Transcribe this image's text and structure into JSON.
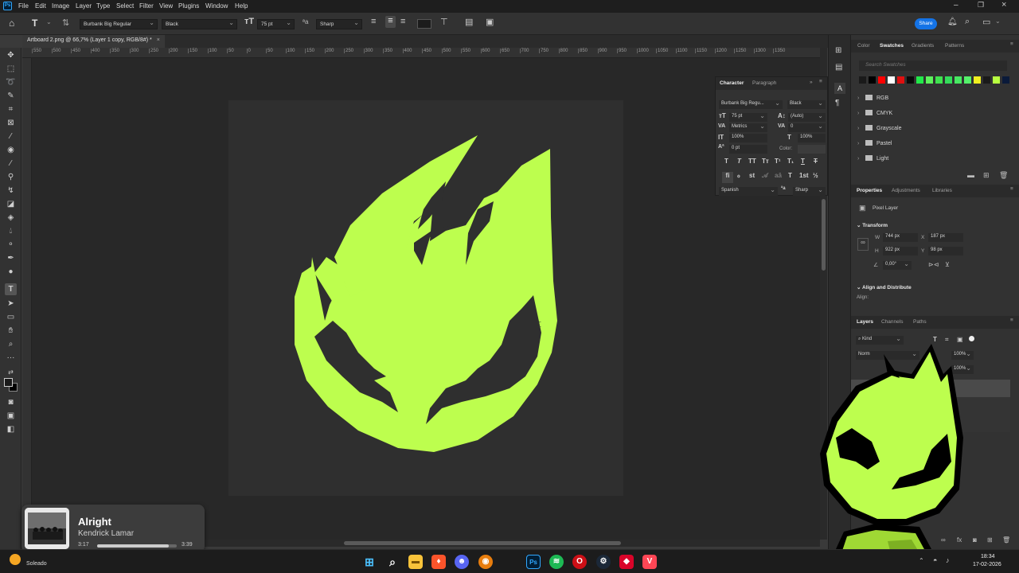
{
  "menu": {
    "app_logo": "Ps",
    "items": [
      "File",
      "Edit",
      "Image",
      "Layer",
      "Type",
      "Select",
      "Filter",
      "View",
      "Plugins",
      "Window",
      "Help"
    ]
  },
  "options_bar": {
    "font_family": "Burbank Big Regular",
    "font_style": "Black",
    "font_size": "75 pt",
    "antialias": "Sharp",
    "share_label": "Share"
  },
  "document": {
    "tab_title": "Artboard 2.png @ 66,7% (Layer 1 copy, RGB/8#) *",
    "close_glyph": "×"
  },
  "ruler": {
    "ticks": [
      "550",
      "500",
      "450",
      "400",
      "350",
      "300",
      "250",
      "200",
      "150",
      "100",
      "50",
      "0",
      "50",
      "100",
      "150",
      "200",
      "250",
      "300",
      "350",
      "400",
      "450",
      "500",
      "550",
      "600",
      "650",
      "700",
      "750",
      "800",
      "850",
      "900",
      "950",
      "1000",
      "1050",
      "1100",
      "1150",
      "1200",
      "1250",
      "1300",
      "1350"
    ]
  },
  "character_panel": {
    "tabs": [
      "Character",
      "Paragraph"
    ],
    "font_family": "Burbank Big Regu...",
    "font_style": "Black",
    "size": "75 pt",
    "leading": "(Auto)",
    "kerning": "Metrics",
    "tracking": "0",
    "vscale": "100%",
    "hscale": "100%",
    "baseline": "0 pt",
    "color_label": "Color:",
    "language": "Spanish",
    "antialias": "Sharp"
  },
  "swatches_panel": {
    "tabs": [
      "Color",
      "Swatches",
      "Gradients",
      "Patterns"
    ],
    "active_tab": "Swatches",
    "search_placeholder": "Search Swatches",
    "colors": [
      "#1a1a1a",
      "#000000",
      "#ff0000",
      "#ffffff",
      "#e01010",
      "#0a0a0a",
      "#23e84a",
      "#5cf25c",
      "#3fe24f",
      "#34dc5a",
      "#47e862",
      "#54f06a",
      "#f0f020",
      "#1a1a1a",
      "#b8ff40",
      "#0a1a3a"
    ],
    "groups": [
      "RGB",
      "CMYK",
      "Grayscale",
      "Pastel",
      "Light"
    ]
  },
  "properties_panel": {
    "tabs": [
      "Properties",
      "Adjustments",
      "Libraries"
    ],
    "layer_type": "Pixel Layer",
    "transform_title": "Transform",
    "w": "744 px",
    "h": "922 px",
    "x": "187 px",
    "y": "98 px",
    "angle": "0,00°",
    "align_title": "Align and Distribute",
    "align_label": "Align:"
  },
  "layers_panel": {
    "tabs": [
      "Layers",
      "Channels",
      "Paths"
    ],
    "filter": "Kind",
    "blend": "Norm",
    "opacity": "100%",
    "fill": "100%"
  },
  "media": {
    "title": "Alright",
    "artist": "Kendrick Lamar",
    "elapsed": "3:17",
    "duration": "3:39",
    "progress": 0.9
  },
  "taskbar": {
    "weather": "Soleado",
    "time": "18:34",
    "date": "17-02-2026",
    "app_icons": [
      "windows-start",
      "search",
      "file-explorer",
      "brave",
      "discord",
      "blender",
      "photoshop",
      "spotify",
      "opera",
      "steam",
      "valorant",
      "another-app"
    ]
  },
  "colors": {
    "logo_lime": "#bdfe4e",
    "accent_blue": "#1473e6"
  }
}
